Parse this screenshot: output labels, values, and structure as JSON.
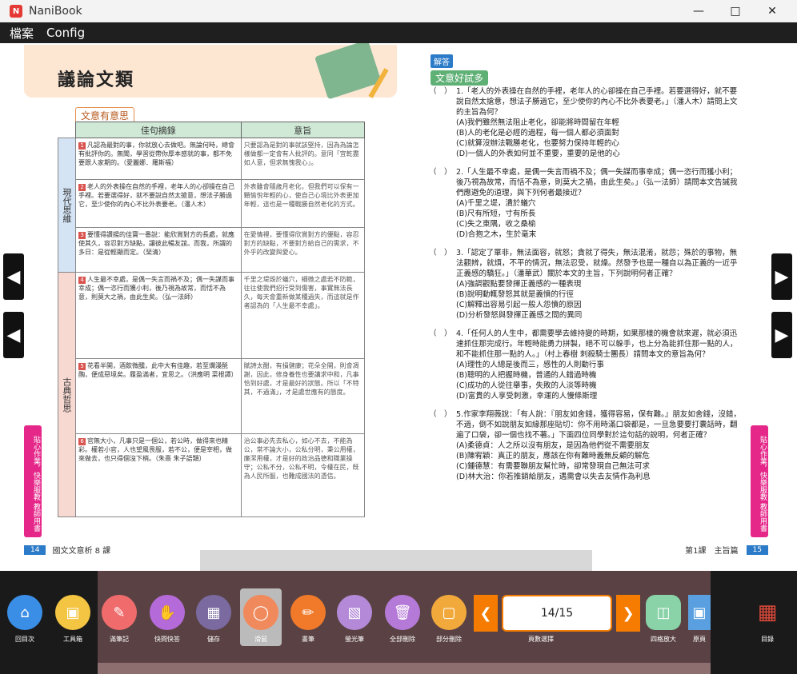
{
  "window": {
    "title": "NaniBook",
    "icon": "app-icon"
  },
  "menu": [
    "檔案",
    "Config"
  ],
  "left_page": {
    "title": "議論文類",
    "section_tag": "文意有意思",
    "table_headers": [
      "佳句摘錄",
      "意旨"
    ],
    "categories": [
      "現代思維",
      "古典哲思"
    ],
    "rows": [
      {
        "num": "1",
        "sentence": "凡認為最對的事，你就放心去做吧。無論何時，總會有批評你的。無聞，學習從帶你厚本感就的事，都不免要跟人家期的。（愛麗娜．羅斯福）",
        "meaning": "只要認為是對的事就該堅持，因為為論怎樣做都一定會有人批評的。意同「宜乾盡如人意，但求無愧我心」。"
      },
      {
        "num": "2",
        "sentence": "老人的外表操在自然的手裡，老年人的心卻操在自己手裡。若要選得好，就不要說自然太搶意，想法子勝過它，至少使你的內心不比外表要老。（潘人木）",
        "meaning": "外表雖會隨歲月老化，但我們可以保有一顆愉悅年輕的心，使自己心境比外表更加年輕，這也是一種戰勝自然老化的方式。"
      },
      {
        "num": "3",
        "sentence": "要懂得讚揚的佳寶一番說：能欣賞對方的長處，就應使其久，容忍對方缺點，讓彼此暢友誼。而我，所謂的多日：是從輕顯而定。（琹清）",
        "meaning": "在愛情裡，要懂得欣賞對方的優點，容忍對方的缺點，不要對方給自己的需求，不外乎的改變與愛心。"
      },
      {
        "num": "4",
        "sentence": "人生最不幸處，是偶一失言而禍不及；偶一失謀而事幸成；偶一恣行而獲小利，後乃視為故常，而恬不為意，則莫大之禍，由此生矣。（弘一法師）",
        "meaning": "千里之堤毀於蟻穴，細微之處若不防範，往往使我們招行受到傷害，事實無法長久，每天會重新做某種過失，而這就是作者認為的「人生最不幸處」。"
      },
      {
        "num": "5",
        "sentence": "花看半開，酒飲微醺，此中大有佳趣，若至爛漫酕醄，便成惡境矣。履盈滿者，宜思之。（洪應明 菜根譚）",
        "meaning": "賦詩太酣，有損健康；花朵全開，則會凋謝，因此，修身養性也要講求中和，凡事恰到好處，才是最好的狀態。所以「不特其，不過滿」，才是處世應有的態度。"
      },
      {
        "num": "6",
        "sentence": "官無大小，凡事只是一個公，若公時，做得來也精彩。權若小官，人也望風畏服，若不公，便是宰相，做來做去，也只得個沒下梢。（朱熹 朱子語類）",
        "meaning": "治公事必先去私心，如心不去，不能為公，常不論大小，公私分明，秉公用權，廉潔用權，才是好的政治品德和職業操守；公私不分，公私不明，令權在民，既為人民所服，也難成國法的憑信。"
      }
    ],
    "side_tab": "貼心作業，快樂服教 教師用書",
    "footer_num": "14",
    "footer_label": "國文文意析 8 課"
  },
  "right_page": {
    "answer_tag": "解答",
    "section_tag": "文意好試多",
    "questions": [
      {
        "paren": "（　）",
        "no": "1.",
        "text": "「老人的外表操在自然的手裡，老年人的心卻操在自己手裡。若要選得好，就不要說自然太搶意，想法子勝過它，至少使你的內心不比外表要老。」（潘人木）請問上文的主旨為何？",
        "options": [
          "(A)我們雖然無法阻止老化，卻能將時間留在年輕",
          "(B)人的老化是必經的過程，每一個人都必須面對",
          "(C)就算沒辦法戰勝老化，也要努力保持年輕的心",
          "(D)一個人的外表如何並不重要，重要的是他的心"
        ]
      },
      {
        "paren": "（　）",
        "no": "2.",
        "text": "「人生最不幸處，是偶一失言而禍不及；偶一失謀而事幸成；偶一恣行而獲小利；後乃視為故常，而恬不為意，則莫大之禍，由此生矣。」（弘一法師）請問本文告誡我們應避免的道理，與下列何者最接近？",
        "options": [
          "(A)千里之堤，潰於蟻穴",
          "(B)尺有所短，寸有所長",
          "(C)失之東隅，收之桑榆",
          "(D)合抱之木，生於毫末"
        ]
      },
      {
        "paren": "（　）",
        "no": "3.",
        "text": "「認定了單非，無法面容，就怒；貪就了得失，無法混淆，就怨；殊於的事物，無法觀辨，就煩，不平的情況，無法忍受，就燥。然發予也是一種自以為正義的一近乎正義感的驕狂。」（潘華武）關於本文的主旨，下列說明何者正確？",
        "options": [
          "(A)強調觀點要發揮正義感的一種表現",
          "(B)說明動輒發怒其就是義憤的行徑",
          "(C)解釋出容易引起一般人怨憤的原因",
          "(D)分析發怒與發揮正義感之間的異同"
        ]
      },
      {
        "paren": "（　）",
        "no": "4.",
        "text": "「任何人的人生中，都需要學去維持變的時期，如果那樣的機會就來遲，就必須迅速抓住那完成行。年輕時能勇力拼製，絕不可以躲手，也上分為能抓住那一點的人，和不能抓住那一點的人。」（村上春樹 刺殺騎士團長）請問本文的意旨為何？",
        "options": [
          "(A)理性的人總是後而三，感性的人則動行事",
          "(B)聰明的人把握時機，普通的人錯過時機",
          "(C)成功的人從往舉事，失敗的人淡等時機",
          "(D)富貴的人享受刺激，幸運的人慢條斯理"
        ]
      },
      {
        "paren": "（　）",
        "no": "5.",
        "text": "作家李翔薇說：「有人說：『朋友如舍錢，獲得容易，保有難。』朋友如舍錢，沒錯，不過，倒不如說朋友如緣那座貼切：你不用時滿口袋都是，一旦急要要打囊話時，翻遍了口袋，卻一個也找不著。」下面四位同學對於這句話的說明，何者正確？",
        "options": [
          "(A)柔德貞：人之所以沒有朋友，是因為他們從不需要朋友",
          "(B)陳宥穎：真正的朋友，應該在你有難時義無反顧的解危",
          "(C)鍾德慧：有需要聯朋友幫忙時，卻常發現自己無法可求",
          "(D)林大治：你若推銷給朋友，遇需會以失去友情作為利息"
        ]
      }
    ],
    "side_tab": "貼心作業，快樂服教 教師用書",
    "footer_label": "第1課　主旨篇",
    "footer_num": "15"
  },
  "toolbar": {
    "tools": [
      {
        "name": "home",
        "label": "回目次",
        "color": "#3a8ee6"
      },
      {
        "name": "toolbox",
        "label": "工具箱",
        "color": "#f4c542"
      },
      {
        "name": "notes",
        "label": "滿筆記",
        "color": "#f06b6b"
      },
      {
        "name": "quick-qa",
        "label": "快問快答",
        "color": "#b46ad8"
      },
      {
        "name": "save",
        "label": "儲存",
        "color": "#7a6aa0"
      },
      {
        "name": "mouse",
        "label": "滑鼠",
        "color": "#f08a5d"
      },
      {
        "name": "pen",
        "label": "畫筆",
        "color": "#f07a2a"
      },
      {
        "name": "highlighter",
        "label": "螢光筆",
        "color": "#b48ad8"
      },
      {
        "name": "delete-all",
        "label": "全部刪除",
        "color": "#b57ad8"
      },
      {
        "name": "partial-delete",
        "label": "部分刪除",
        "color": "#f2a93b"
      }
    ],
    "page_label": "14/15",
    "page_nav_label": "頁數選擇",
    "grid_label": "四格放大",
    "restore_label": "原頁",
    "catalog_label": "目錄"
  }
}
